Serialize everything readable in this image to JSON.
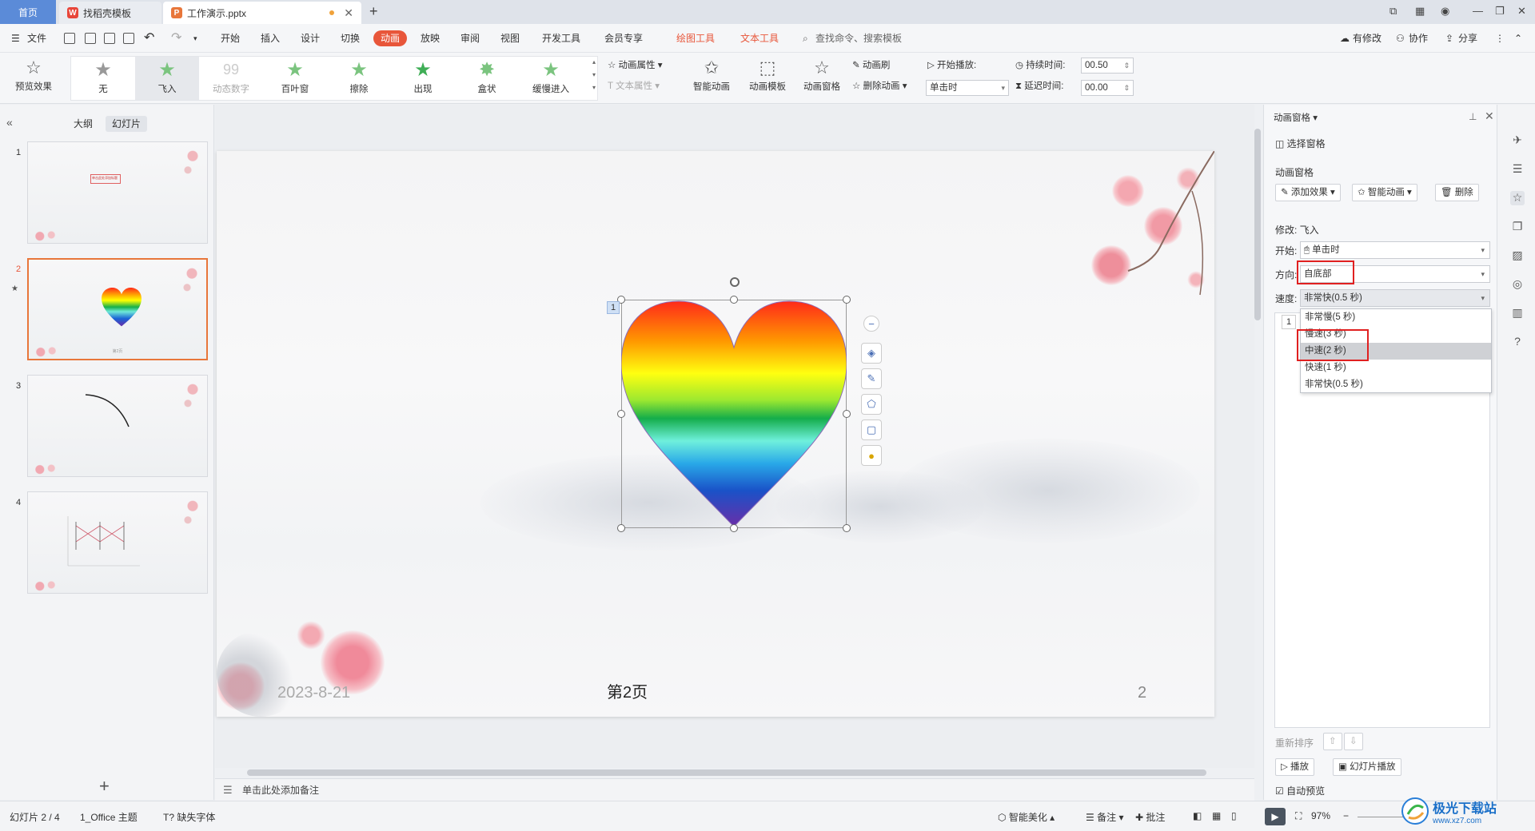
{
  "titlebar": {
    "tabs": [
      {
        "label": "首页"
      },
      {
        "label": "找稻壳模板"
      },
      {
        "label": "工作演示.pptx"
      }
    ]
  },
  "menubar": {
    "file": "文件",
    "items": [
      "开始",
      "插入",
      "设计",
      "切换",
      "动画",
      "放映",
      "审阅",
      "视图",
      "开发工具",
      "会员专享"
    ],
    "context": [
      "绘图工具",
      "文本工具"
    ],
    "search": "查找命令、搜索模板",
    "right": [
      "有修改",
      "协作",
      "分享"
    ]
  },
  "ribbon": {
    "preview": "预览效果",
    "effects": [
      "无",
      "飞入",
      "动态数字",
      "百叶窗",
      "擦除",
      "出现",
      "盒状",
      "缓慢进入"
    ],
    "anim_props": "动画属性",
    "text_props": "文本属性",
    "smart_anim": "智能动画",
    "anim_template": "动画模板",
    "anim_pane": "动画窗格",
    "anim_brush": "动画刷",
    "delete_anim": "删除动画",
    "start_play": "开始播放:",
    "start_value": "单击时",
    "duration_label": "持续时间:",
    "duration_value": "00.50",
    "delay_label": "延迟时间:",
    "delay_value": "00.00"
  },
  "leftpanel": {
    "tabs": [
      "大纲",
      "幻灯片"
    ],
    "slides": [
      "1",
      "2",
      "3",
      "4"
    ],
    "slide1_title": "单击此处添加标题",
    "thumb_footer": "第2页"
  },
  "slide": {
    "shape_index": "1",
    "date": "2023-8-",
    "date_tail": "21",
    "page_title": "第2页",
    "page_num": "2"
  },
  "notes": {
    "placeholder": "单击此处添加备注"
  },
  "rightpane": {
    "title": "动画窗格",
    "select_pane": "选择窗格",
    "section": "动画窗格",
    "add_effect": "添加效果",
    "smart_anim": "智能动画",
    "delete": "删除",
    "modify": "修改: 飞入",
    "start_label": "开始:",
    "start_value": "单击时",
    "direction_label": "方向:",
    "direction_value": "自底部",
    "speed_label": "速度:",
    "speed_value": "非常快(0.5 秒)",
    "speed_options": [
      "非常慢(5 秒)",
      "慢速(3 秒)",
      "中速(2 秒)",
      "快速(1 秒)",
      "非常快(0.5 秒)"
    ],
    "list_item_num": "1",
    "reorder": "重新排序",
    "play": "播放",
    "slideshow": "幻灯片播放",
    "auto_preview": "自动预览"
  },
  "statusbar": {
    "slide_pos": "幻灯片 2 / 4",
    "theme": "1_Office 主题",
    "missing_font": "缺失字体",
    "smart_beautify": "智能美化",
    "notes": "备注",
    "comments": "批注",
    "zoom": "97%"
  },
  "watermark": {
    "text": "极光下载站",
    "url": "www.xz7.com"
  },
  "colors": {
    "accent": "#e8563a",
    "selected_border": "#e8763a",
    "highlight_box": "#e02020"
  }
}
